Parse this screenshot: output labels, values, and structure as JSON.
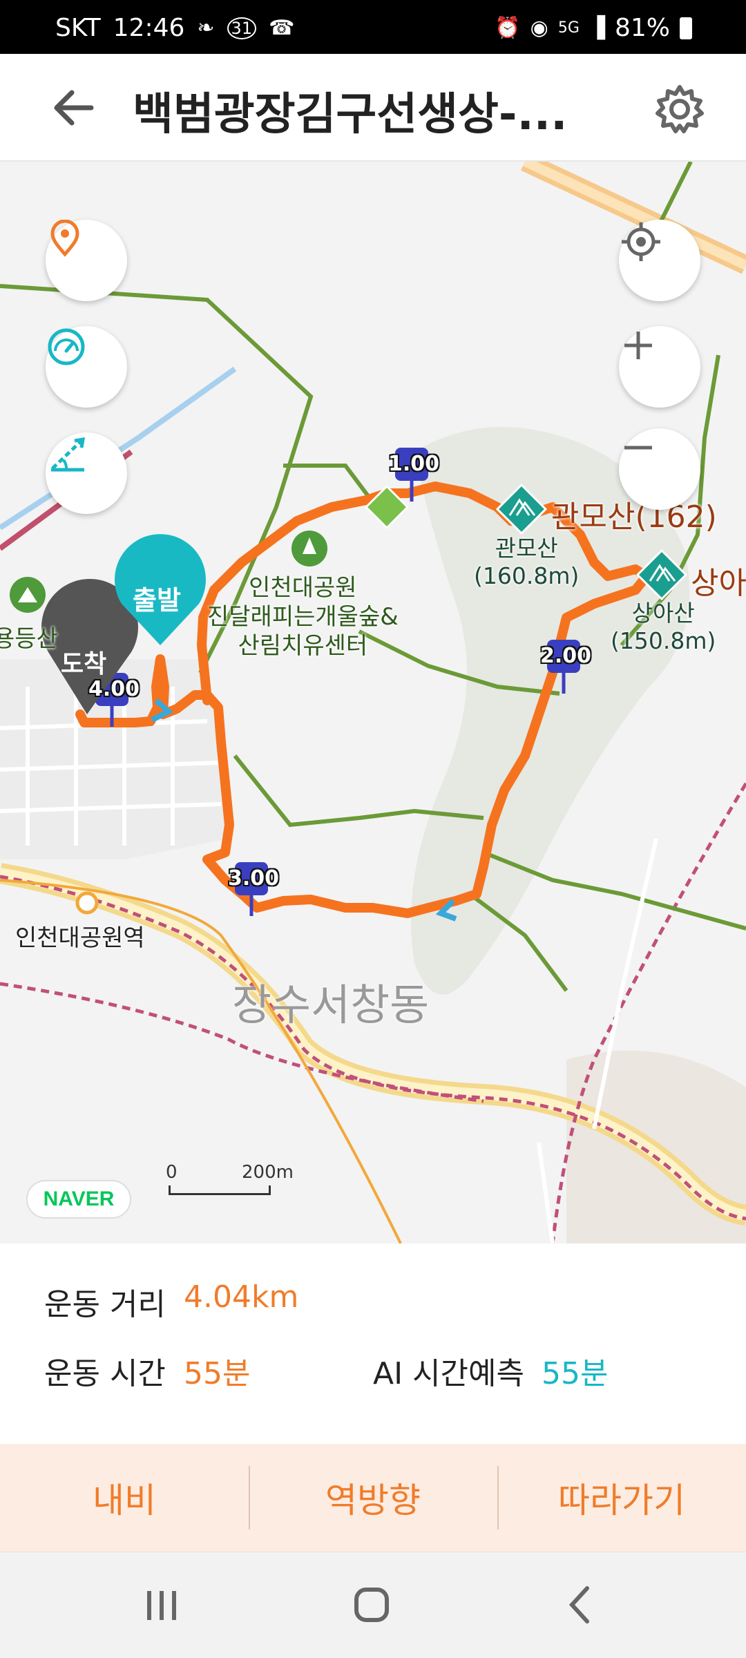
{
  "status_bar": {
    "carrier": "SKT",
    "time": "12:46",
    "notification_icons": [
      "footprint-icon",
      "calendar-31-icon",
      "phone-icon"
    ],
    "right_icons": [
      "alarm-icon",
      "location-icon",
      "5g-icon",
      "signal-icon"
    ],
    "battery": "81%"
  },
  "header": {
    "title": "백범광장김구선생상-...",
    "back_icon": "arrow-left-icon",
    "settings_icon": "gear-icon"
  },
  "map": {
    "buttons": {
      "left": [
        "location-pin-icon",
        "speedometer-icon",
        "slope-icon"
      ],
      "right": [
        "my-location-icon",
        "zoom-in-icon",
        "zoom-out-icon"
      ]
    },
    "start_label": "출발",
    "end_label": "도착",
    "km_markers": [
      "1.00",
      "2.00",
      "3.00",
      "4.00"
    ],
    "park_label_lines": [
      "인천대공원",
      "진달래피는개울숲&",
      "산림치유센터"
    ],
    "left_cut_label": "용등산",
    "peaks": {
      "gwanmo_big": "관모산(162)",
      "gwanmo_small_lines": [
        "관모산",
        "(160.8m)"
      ],
      "sanga_big": "상아",
      "sanga_small_lines": [
        "상아산",
        "(150.8m)"
      ]
    },
    "station": "인천대공원역",
    "dong": "장수서창동",
    "provider_logo": "NAVER",
    "scale": {
      "zero": "0",
      "distance": "200m"
    },
    "colors": {
      "route": "#f5731f",
      "trail": "#6b9a37",
      "marker": "#3a3fc0",
      "start": "#19b9c4",
      "end": "#555555"
    }
  },
  "stats": {
    "distance_label": "운동 거리",
    "distance_value": "4.04km",
    "time_label": "운동 시간",
    "time_value": "55분",
    "ai_label": "AI 시간예측",
    "ai_value": "55분"
  },
  "actions": {
    "navi": "내비",
    "reverse": "역방향",
    "follow": "따라가기"
  },
  "nav_bar": [
    "recent-apps-icon",
    "home-icon",
    "back-icon"
  ]
}
